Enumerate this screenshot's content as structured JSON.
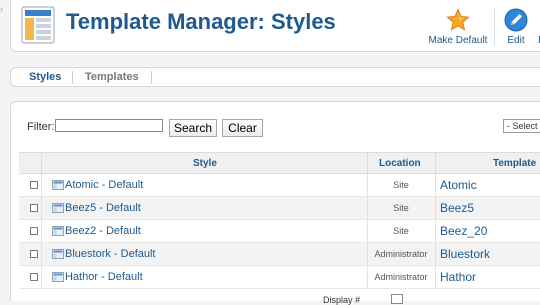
{
  "header": {
    "title": "Template Manager: Styles",
    "logo_icon": "template-manager-icon",
    "toolbar": {
      "make_default": {
        "label": "Make Default",
        "icon": "star-icon",
        "color": "#f29b1e"
      },
      "edit": {
        "label": "Edit",
        "icon": "pencil-icon",
        "color": "#2a7fd4"
      },
      "cut_label": "I"
    }
  },
  "subtabs": [
    {
      "label": "Styles",
      "active": true
    },
    {
      "label": "Templates",
      "active": false
    }
  ],
  "filter": {
    "label": "Filter:",
    "value": "",
    "search_label": "Search",
    "clear_label": "Clear",
    "select_value": "- Select"
  },
  "table": {
    "columns": [
      "Style",
      "Location",
      "Template"
    ],
    "rows": [
      {
        "style": "Atomic - Default",
        "location": "Site",
        "template": "Atomic"
      },
      {
        "style": "Beez5 - Default",
        "location": "Site",
        "template": "Beez5"
      },
      {
        "style": "Beez2 - Default",
        "location": "Site",
        "template": "Beez_20"
      },
      {
        "style": "Bluestork - Default",
        "location": "Administrator",
        "template": "Bluestork"
      },
      {
        "style": "Hathor - Default",
        "location": "Administrator",
        "template": "Hathor"
      }
    ]
  },
  "footer": {
    "display_label": "Display #"
  },
  "colors": {
    "title": "#1e5a8e",
    "link": "#1e5a8e",
    "header_bg": "#f0f0f0",
    "row_alt_bg": "#f3f3f3"
  }
}
